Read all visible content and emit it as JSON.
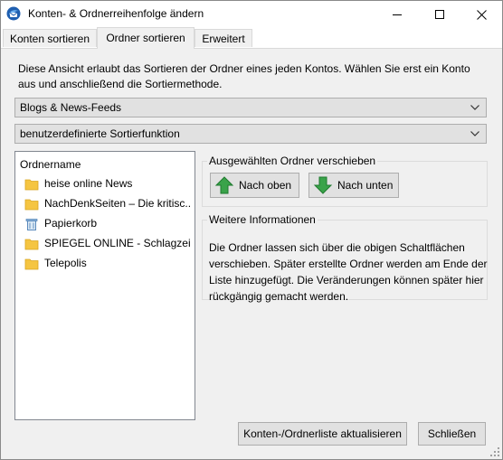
{
  "window": {
    "title": "Konten- & Ordnerreihenfolge ändern",
    "icon": "thunderbird-app-icon",
    "controls": [
      "minimize-icon",
      "maximize-icon",
      "close-icon"
    ]
  },
  "tabs": [
    {
      "label": "Konten sortieren",
      "active": false
    },
    {
      "label": "Ordner sortieren",
      "active": true
    },
    {
      "label": "Erweitert",
      "active": false
    }
  ],
  "description": "Diese Ansicht erlaubt das Sortieren der Ordner eines jeden Kontos. Wählen Sie erst ein Konto aus und anschließend die Sortiermethode.",
  "account_select": {
    "value": "Blogs & News-Feeds"
  },
  "method_select": {
    "value": "benutzerdefinierte Sortierfunktion"
  },
  "folder_list": {
    "header": "Ordnername",
    "items": [
      {
        "label": "heise online News",
        "icon": "folder-icon"
      },
      {
        "label": "NachDenkSeiten – Die kritisc...",
        "icon": "folder-icon"
      },
      {
        "label": "Papierkorb",
        "icon": "trash-icon"
      },
      {
        "label": "SPIEGEL ONLINE - Schlagzeil...",
        "icon": "folder-icon"
      },
      {
        "label": "Telepolis",
        "icon": "folder-icon"
      }
    ]
  },
  "move_group": {
    "legend": "Ausgewählten Ordner verschieben",
    "up_label": "Nach oben",
    "down_label": "Nach unten"
  },
  "info_group": {
    "legend": "Weitere Informationen",
    "text": "Die Ordner lassen sich über die obigen Schaltflächen verschieben. Später erstellte Ordner werden am Ende der Liste hinzugefügt. Die Veränderungen können später hier rückgängig gemacht werden."
  },
  "footer": {
    "refresh_label": "Konten-/Ordnerliste aktualisieren",
    "close_label": "Schließen"
  },
  "colors": {
    "folder": "#f5c542",
    "arrow": "#3aa34a",
    "button_bg": "#e1e1e1",
    "dialog_bg": "#f0f0f0"
  }
}
